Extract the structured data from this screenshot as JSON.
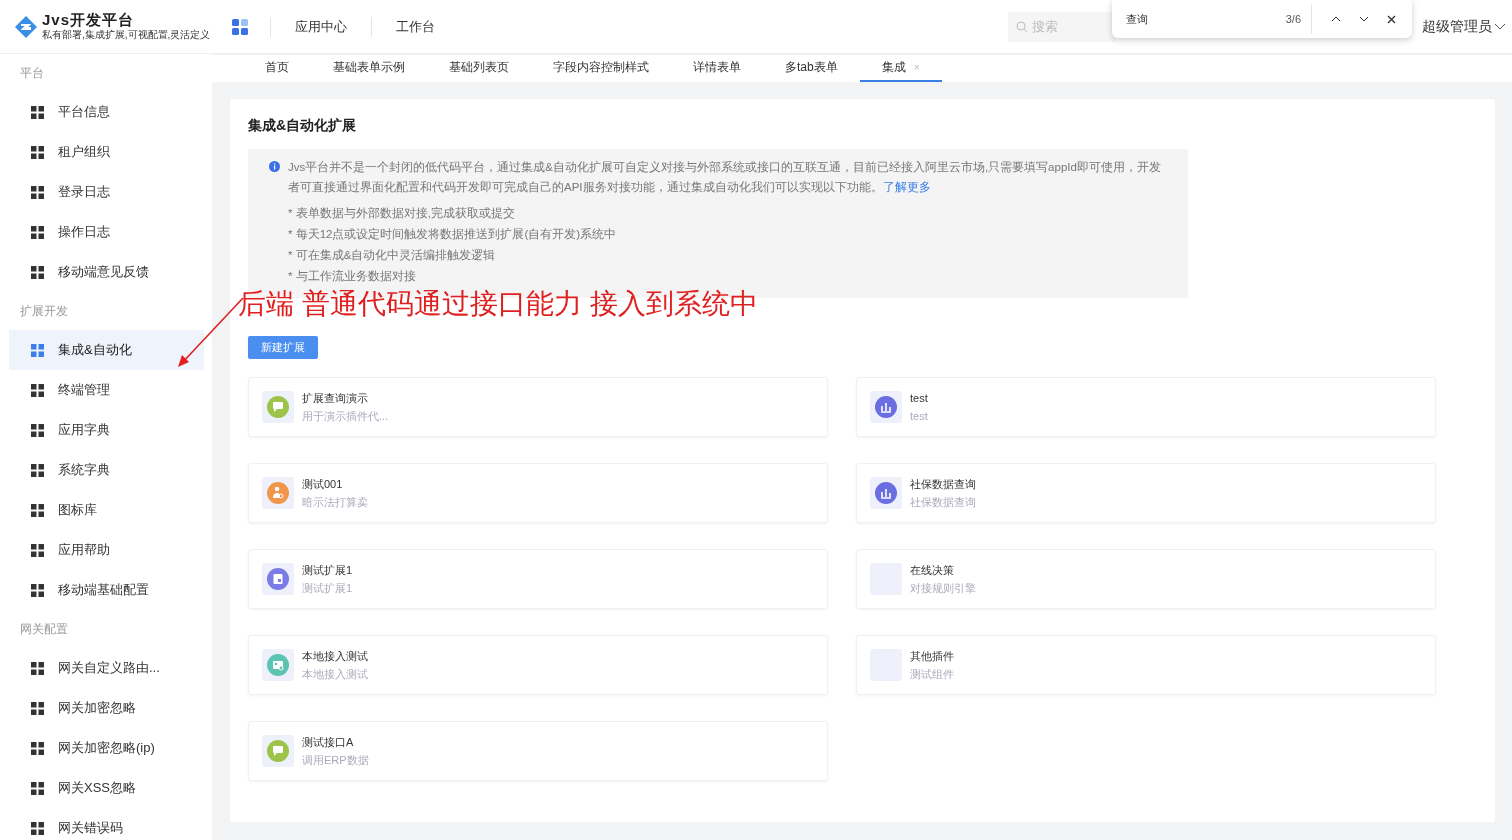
{
  "header": {
    "logo_title": "Jvs开发平台",
    "logo_subtitle": "私有部署,集成扩展,可视配置,灵活定义",
    "nav": [
      "应用中心",
      "工作台"
    ],
    "search": {
      "placeholder": "搜索"
    },
    "user": "超级管理员"
  },
  "find_bar": {
    "query": "查询",
    "count": "3/6"
  },
  "sidebar": {
    "groups": [
      {
        "label": "平台",
        "items": [
          {
            "label": "平台信息",
            "selected": false
          },
          {
            "label": "租户组织",
            "selected": false
          },
          {
            "label": "登录日志",
            "selected": false
          },
          {
            "label": "操作日志",
            "selected": false
          },
          {
            "label": "移动端意见反馈",
            "selected": false
          }
        ]
      },
      {
        "label": "扩展开发",
        "items": [
          {
            "label": "集成&自动化",
            "selected": true
          },
          {
            "label": "终端管理",
            "selected": false
          },
          {
            "label": "应用字典",
            "selected": false
          },
          {
            "label": "系统字典",
            "selected": false
          },
          {
            "label": "图标库",
            "selected": false
          },
          {
            "label": "应用帮助",
            "selected": false
          },
          {
            "label": "移动端基础配置",
            "selected": false
          }
        ]
      },
      {
        "label": "网关配置",
        "items": [
          {
            "label": "网关自定义路由...",
            "selected": false
          },
          {
            "label": "网关加密忽略",
            "selected": false
          },
          {
            "label": "网关加密忽略(ip)",
            "selected": false
          },
          {
            "label": "网关XSS忽略",
            "selected": false
          },
          {
            "label": "网关错误码",
            "selected": false
          }
        ]
      }
    ]
  },
  "tabs": [
    {
      "label": "首页",
      "selected": false
    },
    {
      "label": "基础表单示例",
      "selected": false
    },
    {
      "label": "基础列表页",
      "selected": false
    },
    {
      "label": "字段内容控制样式",
      "selected": false
    },
    {
      "label": "详情表单",
      "selected": false
    },
    {
      "label": "多tab表单",
      "selected": false
    },
    {
      "label": "集成",
      "selected": true,
      "close": "×"
    }
  ],
  "page": {
    "title": "集成&自动化扩展",
    "notice": {
      "text": "Jvs平台并不是一个封闭的低代码平台，通过集成&自动化扩展可自定义对接与外部系统或接口的互联互通，目前已经接入阿里云市场,只需要填写appId即可使用，开发者可直接通过界面化配置和代码开发即可完成自己的API服务对接功能，通过集成自动化我们可以实现以下功能。",
      "link": "了解更多",
      "bullets": [
        "* 表单数据与外部数据对接,完成获取或提交",
        "* 每天12点或设定时间触发将数据推送到扩展(自有开发)系统中",
        "* 可在集成&自动化中灵活编排触发逻辑",
        "* 与工作流业务数据对接"
      ]
    },
    "new_button": "新建扩展",
    "cards": [
      {
        "title": "扩展查询演示",
        "desc": "用于演示插件代...",
        "kind": "chat",
        "color": "#9dc34a"
      },
      {
        "title": "test",
        "desc": "test",
        "kind": "chart",
        "color": "#6b6ee0"
      },
      {
        "title": "测试001",
        "desc": "暗示法打算卖",
        "kind": "person",
        "color": "#f0954a"
      },
      {
        "title": "社保数据查询",
        "desc": "社保数据查询",
        "kind": "chart",
        "color": "#6b6ee0"
      },
      {
        "title": "测试扩展1",
        "desc": "测试扩展1",
        "kind": "form",
        "color": "#7b7be6"
      },
      {
        "title": "在线决策",
        "desc": "对接规则引擎",
        "kind": "blank"
      },
      {
        "title": "本地接入测试",
        "desc": "本地接入测试",
        "kind": "card",
        "color": "#5cc4b0"
      },
      {
        "title": "其他插件",
        "desc": "测试组件",
        "kind": "blank"
      },
      {
        "title": "测试接口A",
        "desc": "调用ERP数据",
        "kind": "chat",
        "color": "#9dc34a"
      }
    ]
  },
  "annotation": {
    "text": "后端 普通代码通过接口能力 接入到系统中"
  }
}
